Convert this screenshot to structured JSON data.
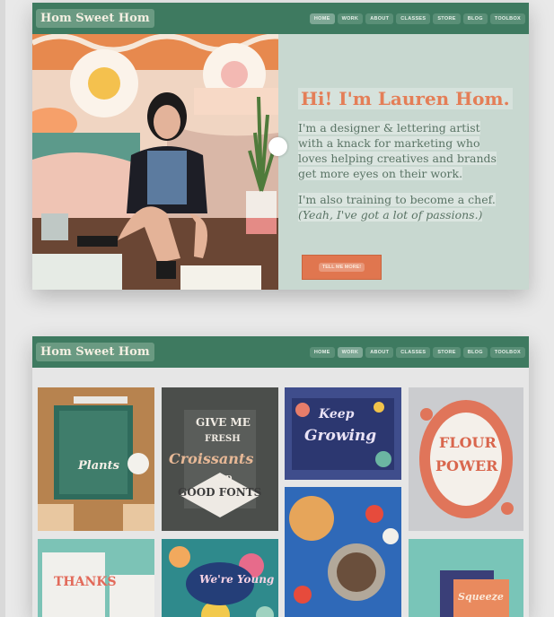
{
  "top_window": {
    "logo": "Hom Sweet Hom",
    "nav": [
      "HOME",
      "WORK",
      "ABOUT",
      "CLASSES",
      "STORE",
      "BLOG",
      "TOOLBOX"
    ],
    "hero_title": "Hi! I'm Lauren Hom.",
    "hero_para1": [
      "I'm a designer & lettering artist",
      "with a knack for marketing who",
      "loves helping creatives and brands",
      "get more eyes on their work."
    ],
    "hero_para2_line1": "I'm also training to become a chef.",
    "hero_para2_line2": "(Yeah, I've got a lot of passions.)",
    "cta": "TELL ME MORE!"
  },
  "bottom_window": {
    "logo": "Hom Sweet Hom",
    "nav": [
      "HOME",
      "WORK",
      "ABOUT",
      "CLASSES",
      "STORE",
      "BLOG",
      "TOOLBOX"
    ],
    "tiles": {
      "plants": "Plants",
      "croissant_1": "GIVE ME",
      "croissant_2": "FRESH",
      "croissant_3": "Croissants",
      "croissant_4": "AND",
      "croissant_5": "GOOD FONTS",
      "keep_growing_1": "Keep",
      "keep_growing_2": "Growing",
      "flower_1": "FLOUR",
      "flower_2": "POWER",
      "thanks": "THANKS",
      "werr_young": "We're Young",
      "squeeze": "Squeeze"
    }
  },
  "colors": {
    "nav_green": "#3e7a60",
    "accent_orange": "#e0764f",
    "hero_bg": "#c8d8d0"
  }
}
